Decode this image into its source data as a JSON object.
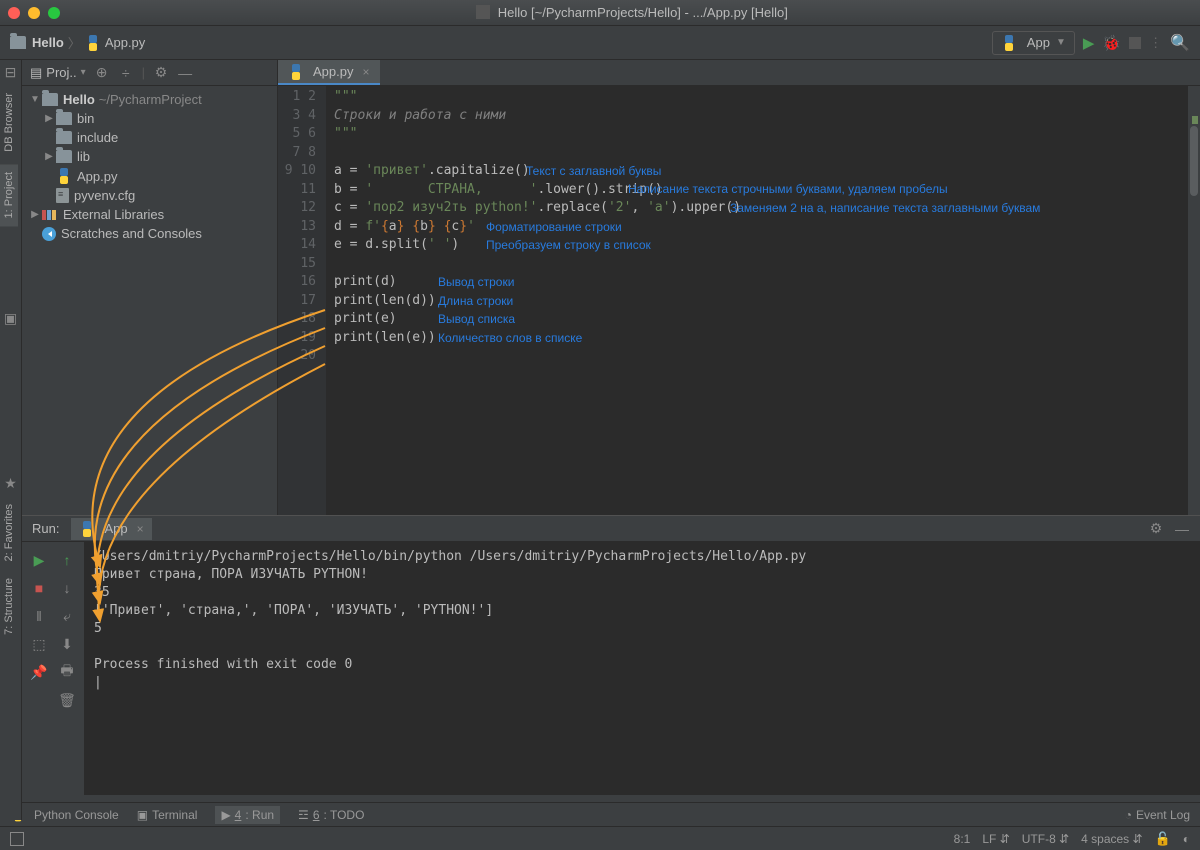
{
  "window": {
    "title": "Hello [~/PycharmProjects/Hello] - .../App.py [Hello]"
  },
  "breadcrumb": {
    "root": "Hello",
    "file": "App.py"
  },
  "runConfig": {
    "name": "App"
  },
  "projPanel": {
    "header": "Proj..",
    "root": "Hello",
    "rootPath": "~/PycharmProject",
    "items": [
      "bin",
      "include",
      "lib",
      "App.py",
      "pyvenv.cfg"
    ],
    "extLib": "External Libraries",
    "scratches": "Scratches and Consoles"
  },
  "editorTab": {
    "name": "App.py"
  },
  "code": {
    "l1": "\"\"\"",
    "l2": "Строки и работа с ними",
    "l3": "\"\"\"",
    "l5a": "a = ",
    "l5b": "'привет'",
    "l5c": ".capitalize()",
    "l6a": "b = ",
    "l6b": "'       СТРАНА,      '",
    "l6c": ".lower().strip()",
    "l7a": "c = ",
    "l7b": "'пор2 изуч2ть python!'",
    "l7c": ".replace(",
    "l7d": "'2'",
    "l7e": ", ",
    "l7f": "'a'",
    "l7g": ").upper()",
    "l8a": "d = ",
    "l8b": "f'",
    "l8c": "{",
    "l8d": "a",
    "l8e": "}",
    " l8f": " ",
    "l8g": "{",
    "l8h": "b",
    "l8i": "}",
    " l8j": " ",
    "l8k": "{",
    "l8l": "c",
    "l8m": "}",
    "l8n": "'",
    "l9a": "e = d.split(",
    "l9b": "' '",
    "l9c": ")",
    "l11": "print(d)",
    "l12": "print(len(d))",
    "l13": "print(e)",
    "l14": "print(len(e))"
  },
  "annotations": {
    "a5": "Текст с заглавной буквы",
    "a6": "Написание текста строчными буквами, удаляем пробелы",
    "a7": "Заменяем 2 на а, написание текста заглавными буквам",
    "a8": "Форматирование строки",
    "a9": "Преобразуем строку в список",
    "a11": "Вывод строки",
    "a12": "Длина строки",
    "a13": "Вывод списка",
    "a14": "Количество слов в списке"
  },
  "run": {
    "title": "Run:",
    "tab": "App",
    "out1": "/Users/dmitriy/PycharmProjects/Hello/bin/python /Users/dmitriy/PycharmProjects/Hello/App.py",
    "out2": "Привет страна, ПОРА ИЗУЧАТЬ PYTHON!",
    "out3": "35",
    "out4": "['Привет', 'страна,', 'ПОРА', 'ИЗУЧАТЬ', 'PYTHON!']",
    "out5": "5",
    "out6": "Process finished with exit code 0"
  },
  "sideTabs": {
    "db": "DB Browser",
    "project": "1: Project",
    "favorites": "2: Favorites",
    "structure": "7: Structure"
  },
  "bottomTabs": {
    "console": "Python Console",
    "terminal": "Terminal",
    "run": "4: Run",
    "run_u": "4",
    "todo": "6: TODO",
    "todo_u": "6",
    "eventLog": "Event Log"
  },
  "status": {
    "pos": "8:1",
    "lf": "LF",
    "enc": "UTF-8",
    "indent": "4 spaces"
  }
}
